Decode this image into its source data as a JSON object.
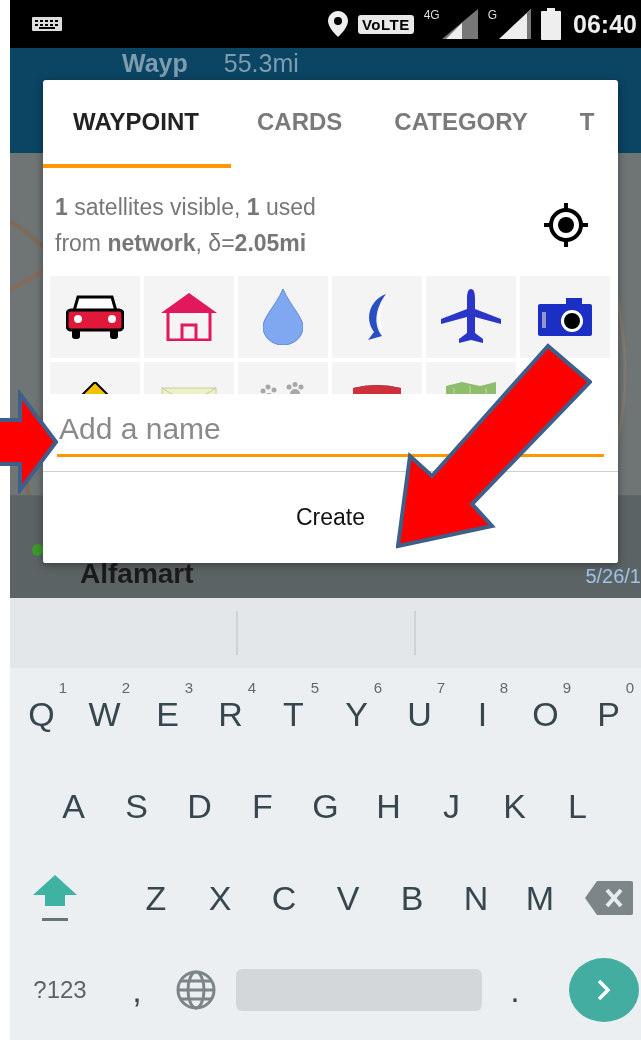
{
  "status_bar": {
    "volte": "VoLTE",
    "network_1": "4G",
    "network_2": "G",
    "time": "06:40"
  },
  "app_bar": {
    "title": "Wayp",
    "distance": "55.3mi"
  },
  "list_item": {
    "title": "Alfamart",
    "date": "5/26/1"
  },
  "dialog": {
    "tabs": [
      {
        "label": "WAYPOINT",
        "selected": true
      },
      {
        "label": "CARDS",
        "selected": false
      },
      {
        "label": "CATEGORY",
        "selected": false
      },
      {
        "label": "T",
        "selected": false
      }
    ],
    "info_lines": [
      "**1** satellites visible, **1** used",
      "from **network**, δ=**2.05mi**"
    ],
    "icons": [
      {
        "kind": "car"
      },
      {
        "kind": "house"
      },
      {
        "kind": "drop"
      },
      {
        "kind": "fish"
      },
      {
        "kind": "plane"
      },
      {
        "kind": "camera"
      },
      {
        "kind": "sign"
      },
      {
        "kind": "envelope"
      },
      {
        "kind": "paws"
      },
      {
        "kind": "shield"
      },
      {
        "kind": "map"
      }
    ],
    "name_field": {
      "placeholder": "Add a name"
    },
    "create_button": "Create"
  },
  "keyboard": {
    "rows": [
      [
        {
          "label": "Q",
          "hint": "1"
        },
        {
          "label": "W",
          "hint": "2"
        },
        {
          "label": "E",
          "hint": "3"
        },
        {
          "label": "R",
          "hint": "4"
        },
        {
          "label": "T",
          "hint": "5"
        },
        {
          "label": "Y",
          "hint": "6"
        },
        {
          "label": "U",
          "hint": "7"
        },
        {
          "label": "I",
          "hint": "8"
        },
        {
          "label": "O",
          "hint": "9"
        },
        {
          "label": "P",
          "hint": "0"
        }
      ],
      [
        {
          "label": "A"
        },
        {
          "label": "S"
        },
        {
          "label": "D"
        },
        {
          "label": "F"
        },
        {
          "label": "G"
        },
        {
          "label": "H"
        },
        {
          "label": "J"
        },
        {
          "label": "K"
        },
        {
          "label": "L"
        }
      ],
      [
        {
          "label": "Z"
        },
        {
          "label": "X"
        },
        {
          "label": "C"
        },
        {
          "label": "V"
        },
        {
          "label": "B"
        },
        {
          "label": "N"
        },
        {
          "label": "M"
        }
      ]
    ],
    "symbols_key": "?123",
    "comma_key": ",",
    "period_key": "."
  }
}
